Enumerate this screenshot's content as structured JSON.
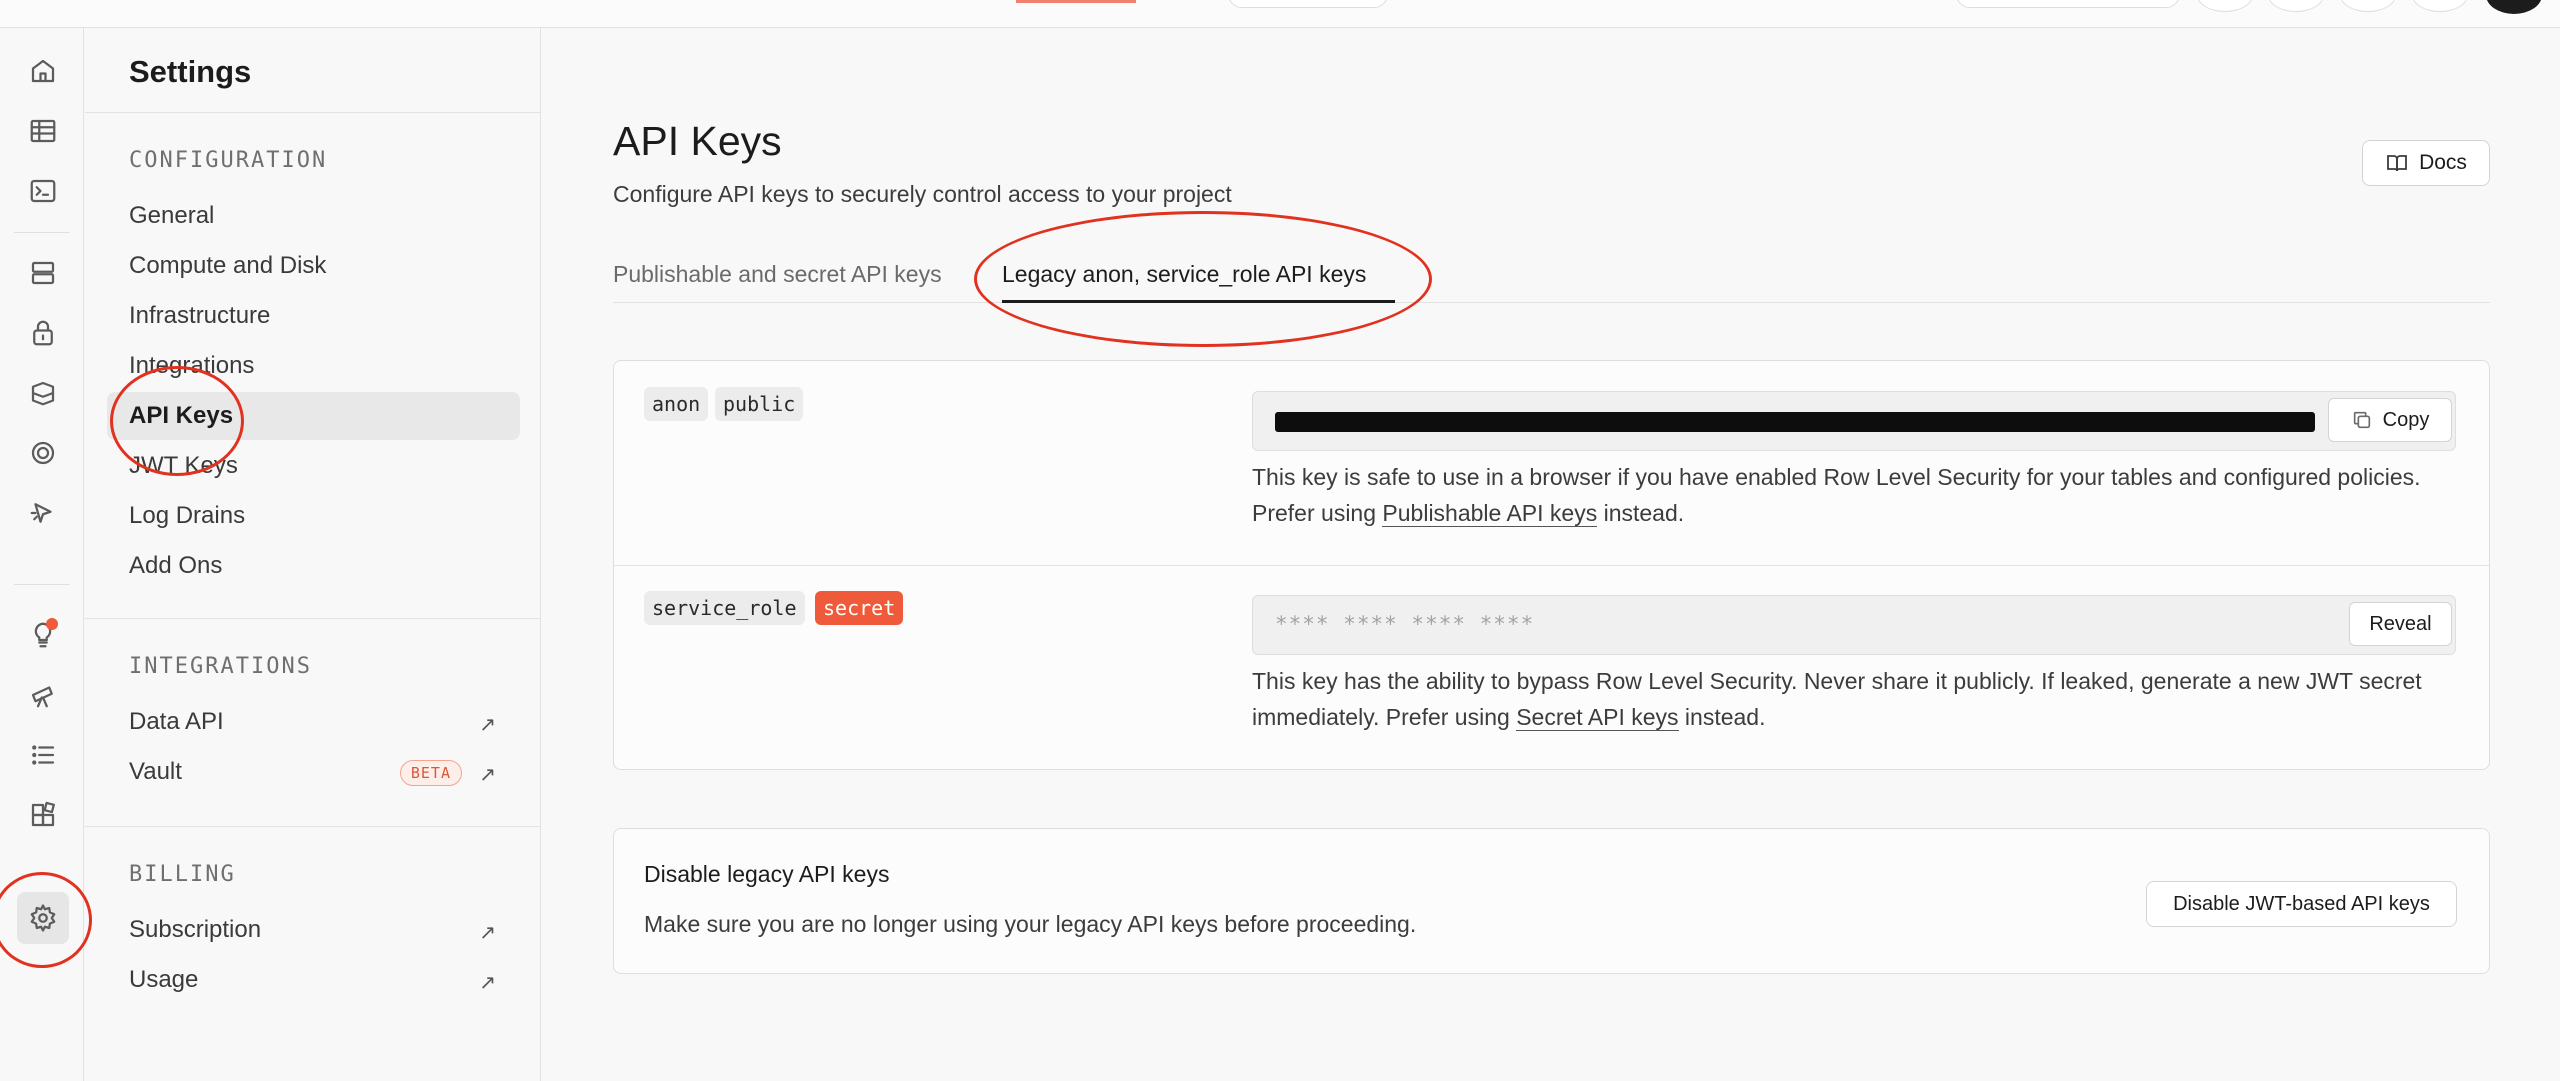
{
  "rail": {
    "items": [
      {
        "icon": "home-icon"
      },
      {
        "icon": "table-editor-icon"
      },
      {
        "icon": "sql-editor-icon"
      },
      {
        "icon": "database-icon"
      },
      {
        "icon": "auth-lock-icon"
      },
      {
        "icon": "storage-icon"
      },
      {
        "icon": "realtime-icon"
      },
      {
        "icon": "edge-functions-icon"
      },
      {
        "icon": "advisors-bulb-icon"
      },
      {
        "icon": "telescope-icon"
      },
      {
        "icon": "logs-list-icon"
      },
      {
        "icon": "integrations-icon"
      },
      {
        "icon": "settings-gear-icon",
        "active": true
      }
    ]
  },
  "sidebar": {
    "title": "Settings",
    "configuration": {
      "label": "CONFIGURATION",
      "items": [
        "General",
        "Compute and Disk",
        "Infrastructure",
        "Integrations",
        "API Keys",
        "JWT Keys",
        "Log Drains",
        "Add Ons"
      ],
      "active": "API Keys"
    },
    "integrations": {
      "label": "INTEGRATIONS",
      "items": [
        {
          "label": "Data API",
          "external": true
        },
        {
          "label": "Vault",
          "badge": "BETA",
          "external": true
        }
      ]
    },
    "billing": {
      "label": "BILLING",
      "items": [
        {
          "label": "Subscription",
          "external": true
        },
        {
          "label": "Usage",
          "external": true
        }
      ]
    }
  },
  "main": {
    "title": "API Keys",
    "subtitle": "Configure API keys to securely control access to your project",
    "docs_label": "Docs",
    "tabs": [
      "Publishable and secret API keys",
      "Legacy anon, service_role API keys"
    ],
    "active_tab": "Legacy anon, service_role API keys",
    "anon": {
      "tag1": "anon",
      "tag2": "public",
      "copy_label": "Copy",
      "desc_prefix": "This key is safe to use in a browser if you have enabled Row Level Security for your tables and configured policies. Prefer using ",
      "desc_link": "Publishable API keys",
      "desc_suffix": " instead."
    },
    "service_role": {
      "tag1": "service_role",
      "tag2": "secret",
      "masked_value": "**** **** **** ****",
      "reveal_label": "Reveal",
      "desc_prefix": "This key has the ability to bypass Row Level Security. Never share it publicly. If leaked, generate a new JWT secret immediately. Prefer using ",
      "desc_link": "Secret API keys",
      "desc_suffix": " instead."
    },
    "disable": {
      "title": "Disable legacy API keys",
      "subtitle": "Make sure you are no longer using your legacy API keys before proceeding.",
      "button_label": "Disable JWT-based API keys"
    }
  },
  "colors": {
    "accent_red": "#ef5b3a",
    "annotation_red": "#e0321f"
  }
}
